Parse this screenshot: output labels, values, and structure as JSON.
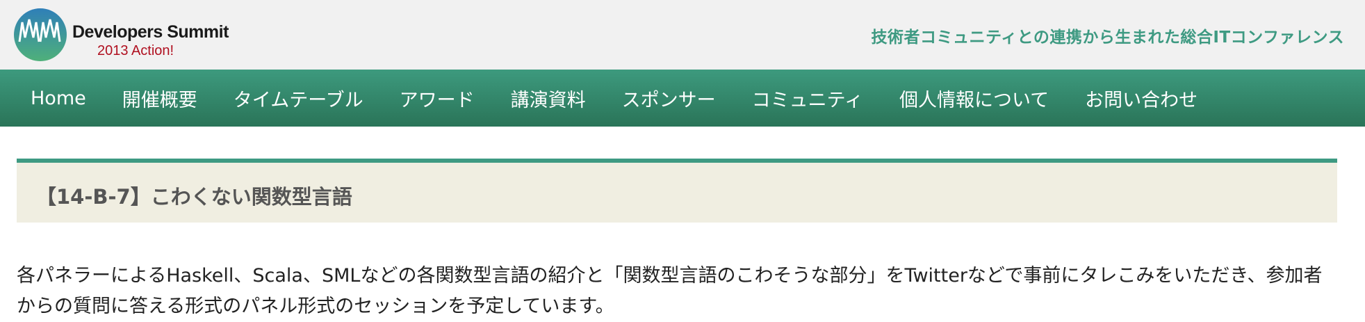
{
  "header": {
    "logo_title": "Developers Summit",
    "logo_subtitle": "2013 Action!",
    "tagline": "技術者コミュニティとの連携から生まれた総合ITコンファレンス"
  },
  "nav": {
    "items": [
      {
        "label": "Home"
      },
      {
        "label": "開催概要"
      },
      {
        "label": "タイムテーブル"
      },
      {
        "label": "アワード"
      },
      {
        "label": "講演資料"
      },
      {
        "label": "スポンサー"
      },
      {
        "label": "コミュニティ"
      },
      {
        "label": "個人情報について"
      },
      {
        "label": "お問い合わせ"
      }
    ]
  },
  "main": {
    "session_title": "【14-B-7】こわくない関数型言語",
    "description": "各パネラーによるHaskell、Scala、SMLなどの各関数型言語の紹介と「関数型言語のこわそうな部分」をTwitterなどで事前にタレこみをいただき、参加者からの質問に答える形式のパネル形式のセッションを予定しています。"
  },
  "colors": {
    "accent": "#3e9a82",
    "nav_top": "#3d9a7e",
    "nav_bottom": "#2a7458",
    "header_bg": "#f1f1f1",
    "section_bg": "#f0eee1",
    "logo_subtitle": "#b01020"
  }
}
